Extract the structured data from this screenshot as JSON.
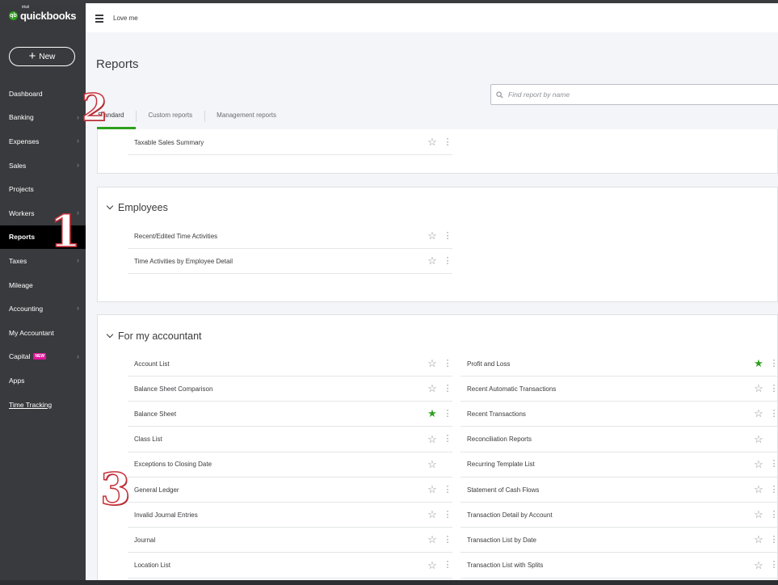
{
  "brand": {
    "intuit": "intuit",
    "name": "quickbooks"
  },
  "sidebar": {
    "new_label": "New",
    "items": [
      {
        "label": "Dashboard",
        "chevron": false
      },
      {
        "label": "Banking",
        "chevron": true
      },
      {
        "label": "Expenses",
        "chevron": true
      },
      {
        "label": "Sales",
        "chevron": true
      },
      {
        "label": "Projects",
        "chevron": false
      },
      {
        "label": "Workers",
        "chevron": true
      },
      {
        "label": "Reports",
        "chevron": false,
        "active": true
      },
      {
        "label": "Taxes",
        "chevron": true
      },
      {
        "label": "Mileage",
        "chevron": false
      },
      {
        "label": "Accounting",
        "chevron": true
      },
      {
        "label": "My Accountant",
        "chevron": false
      },
      {
        "label": "Capital",
        "chevron": true,
        "badge": "NEW"
      },
      {
        "label": "Apps",
        "chevron": false
      },
      {
        "label": "Time Tracking",
        "chevron": false,
        "link": true
      }
    ]
  },
  "header": {
    "company": "Love me"
  },
  "page": {
    "title": "Reports"
  },
  "search": {
    "placeholder": "Find report by name"
  },
  "tabs": [
    "Standard",
    "Custom reports",
    "Management reports"
  ],
  "sections": {
    "partial": {
      "reports": [
        {
          "name": "Taxable Sales Summary",
          "fav": false
        }
      ]
    },
    "employees": {
      "title": "Employees",
      "reports": [
        {
          "name": "Recent/Edited Time Activities",
          "fav": false
        },
        {
          "name": "Time Activities by Employee Detail",
          "fav": false
        }
      ]
    },
    "accountant": {
      "title": "For my accountant",
      "left": [
        {
          "name": "Account List",
          "fav": false
        },
        {
          "name": "Balance Sheet Comparison",
          "fav": false
        },
        {
          "name": "Balance Sheet",
          "fav": true
        },
        {
          "name": "Class List",
          "fav": false
        },
        {
          "name": "Exceptions to Closing Date",
          "fav": false,
          "no_menu": true
        },
        {
          "name": "General Ledger",
          "fav": false
        },
        {
          "name": "Invalid Journal Entries",
          "fav": false
        },
        {
          "name": "Journal",
          "fav": false
        },
        {
          "name": "Location List",
          "fav": false
        }
      ],
      "right": [
        {
          "name": "Profit and Loss",
          "fav": true
        },
        {
          "name": "Recent Automatic Transactions",
          "fav": false
        },
        {
          "name": "Recent Transactions",
          "fav": false
        },
        {
          "name": "Reconciliation Reports",
          "fav": false,
          "no_menu": true
        },
        {
          "name": "Recurring Template List",
          "fav": false
        },
        {
          "name": "Statement of Cash Flows",
          "fav": false
        },
        {
          "name": "Transaction Detail by Account",
          "fav": false
        },
        {
          "name": "Transaction List by Date",
          "fav": false
        },
        {
          "name": "Transaction List with Splits",
          "fav": false
        }
      ]
    }
  },
  "annotations": [
    "1",
    "2",
    "3"
  ],
  "colors": {
    "sidebar": "#393a3d",
    "accent": "#2ca01c",
    "annotation": "#c8323c"
  }
}
